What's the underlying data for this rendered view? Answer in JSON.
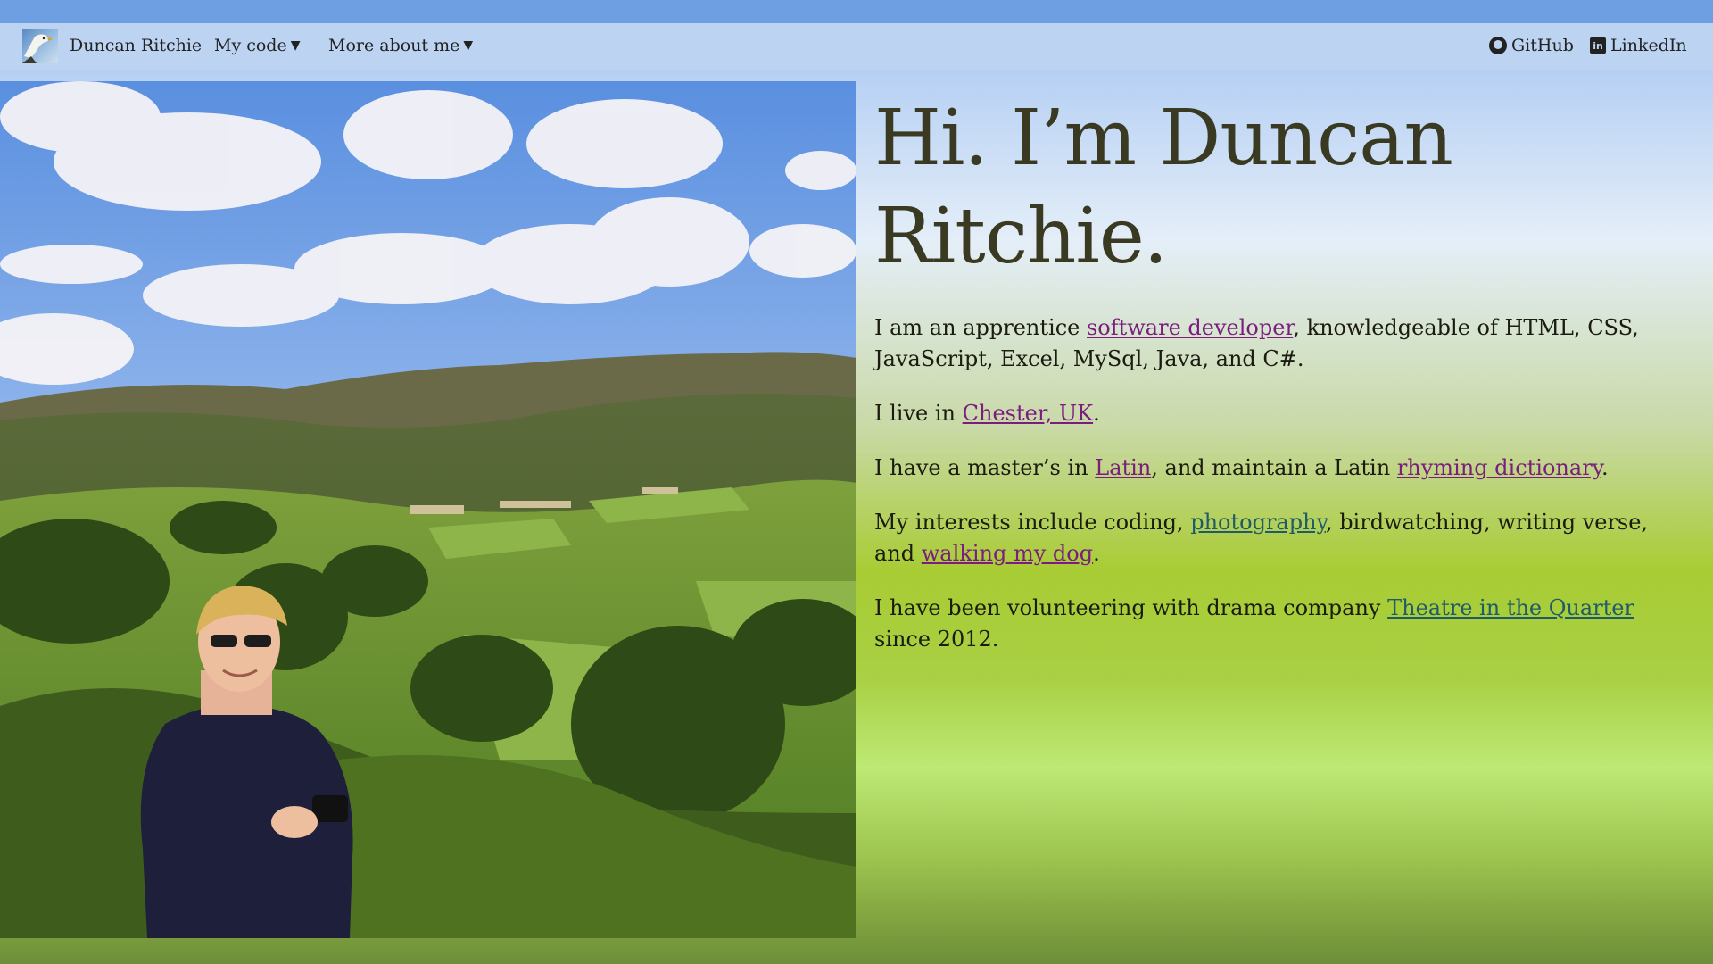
{
  "nav": {
    "logo_icon": "eagle-logo-icon",
    "brand": "Duncan Ritchie",
    "menu_code": "My code",
    "menu_more": "More about me",
    "caret_icon": "caret-down-icon",
    "github_label": "GitHub",
    "github_icon": "github-icon",
    "linkedin_label": "LinkedIn",
    "linkedin_icon": "linkedin-icon"
  },
  "hero": {
    "headline": "Hi. I’m Duncan Ritchie.",
    "p1": {
      "before": "I am an apprentice ",
      "link": "software developer",
      "after": ", knowledgeable of HTML, CSS, JavaScript, Excel, MySql, Java, and C#."
    },
    "p2": {
      "before": "I live in ",
      "link": "Chester, UK",
      "after": "."
    },
    "p3": {
      "before": "I have a master’s in ",
      "link1": "Latin",
      "middle": ", and maintain a Latin ",
      "link2": "rhyming dictionary",
      "after": "."
    },
    "p4": {
      "before": "My interests include coding, ",
      "link1": "photography",
      "middle": ", birdwatching, writing verse, and ",
      "link2": "walking my dog",
      "after": "."
    },
    "p5": {
      "before": "I have been volunteering with drama company ",
      "link": "Theatre in the Quarter",
      "after": " since 2012."
    }
  },
  "colors": {
    "link_visited": "#7b1c7f",
    "link_unvisited": "#1f5b68",
    "navbar_bg": "#bcd4f2",
    "top_strip": "#6f9fe3",
    "heading": "#3a3a22"
  }
}
